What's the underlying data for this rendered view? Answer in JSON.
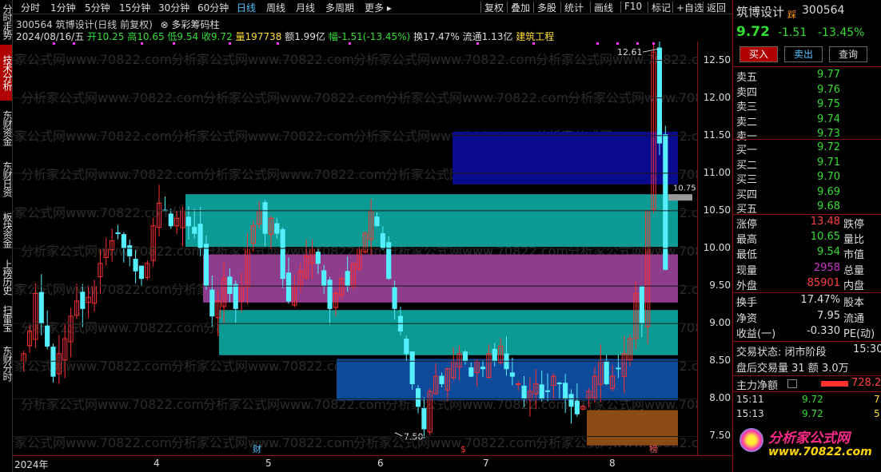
{
  "left_tabs": [
    {
      "label": "分时走势",
      "active": false
    },
    {
      "label": "技术分析",
      "active": true
    },
    {
      "label": "东财资金",
      "active": false
    },
    {
      "label": "东财日资",
      "active": false
    },
    {
      "label": "板块资金",
      "active": false
    },
    {
      "label": "上榜历史",
      "active": false
    },
    {
      "label": "扫雷宝",
      "active": false
    },
    {
      "label": "东财分时",
      "active": false
    }
  ],
  "toolbar": {
    "periods": [
      "分时",
      "1分钟",
      "5分钟",
      "15分钟",
      "30分钟",
      "60分钟",
      "日线",
      "周线",
      "月线",
      "多周期",
      "更多 ▸"
    ],
    "selected": "日线",
    "tools": [
      "复权",
      "叠加",
      "多股",
      "统计",
      "画线",
      "F10",
      "标记",
      "+自选",
      "返回"
    ]
  },
  "info": {
    "line1": "300564 筑博设计(日线 前复权)",
    "indicator": "多彩筹码柱",
    "date": "2024/08/16/五",
    "open": "开10.25",
    "high": "高10.65",
    "low": "低9.54",
    "close": "收9.72",
    "volume": "量197738",
    "amount": "额1.99亿",
    "change": "幅-1.51(-13.45%)",
    "turnover": "换17.47%",
    "float": "流通1.13亿",
    "industry": "建筑工程"
  },
  "watermark": "分析家公式网www.70822.com",
  "chart_data": {
    "type": "candlestick",
    "ylim": [
      7.25,
      12.75
    ],
    "yticks": [
      "12.50",
      "12.00",
      "11.50",
      "11.00",
      "10.50",
      "10.00",
      "9.50",
      "9.00",
      "8.50",
      "8.00",
      "7.50"
    ],
    "xticks": [
      "2024年",
      "4",
      "5",
      "6",
      "7",
      "8"
    ],
    "x_markers": [
      {
        "label": "财",
        "color": "#4fc3ff"
      },
      {
        "label": "$",
        "color": "#ff3030"
      },
      {
        "label": "榜",
        "color": "#ff6060"
      }
    ],
    "annotations": [
      "12.61",
      "7.50",
      "10.75"
    ],
    "chip_bands": [
      {
        "low": 10.85,
        "high": 11.55,
        "color": "#0a0a8c"
      },
      {
        "low": 10.02,
        "high": 10.72,
        "color": "#0c9a94"
      },
      {
        "low": 9.28,
        "high": 9.92,
        "color": "#8e3c8c"
      },
      {
        "low": 8.58,
        "high": 9.18,
        "color": "#0c9a94"
      },
      {
        "low": 7.98,
        "high": 8.53,
        "color": "#0d4a9a"
      },
      {
        "low": 7.38,
        "high": 7.85,
        "color": "#8c4a14"
      }
    ],
    "closes": [
      8.6,
      8.9,
      9.4,
      9.0,
      8.7,
      8.3,
      8.6,
      8.8,
      9.1,
      9.3,
      9.2,
      9.35,
      9.5,
      9.8,
      10.0,
      10.1,
      10.2,
      10.0,
      9.9,
      9.7,
      9.6,
      9.8,
      10.3,
      10.6,
      10.5,
      10.3,
      10.4,
      10.5,
      10.3,
      10.2,
      10.0,
      9.5,
      9.1,
      9.3,
      9.6,
      9.4,
      9.2,
      9.5,
      10.0,
      10.3,
      10.5,
      10.2,
      10.4,
      10.2,
      9.6,
      9.3,
      9.5,
      9.7,
      9.9,
      10.0,
      9.8,
      9.5,
      9.2,
      9.4,
      9.6,
      9.5,
      9.8,
      10.0,
      10.2,
      10.5,
      10.3,
      10.0,
      9.6,
      9.2,
      8.9,
      8.6,
      8.2,
      7.9,
      7.6,
      8.1,
      8.3,
      8.2,
      8.4,
      8.5,
      8.6,
      8.5,
      8.3,
      8.5,
      8.4,
      8.6,
      8.5,
      8.7,
      8.4,
      8.3,
      8.2,
      8.0,
      8.1,
      8.2,
      8.0,
      8.1,
      8.3,
      8.2,
      8.0,
      7.9,
      7.8,
      7.9,
      8.1,
      8.3,
      8.5,
      8.2,
      8.3,
      8.4,
      8.6,
      8.8,
      9.4,
      9.0,
      10.5,
      12.61,
      11.4,
      9.72
    ]
  },
  "panel": {
    "name": "筑博设计",
    "tag": "踩",
    "code": "300564",
    "price": "9.72",
    "chg": "-1.51",
    "pct": "-13.45%",
    "buttons": [
      "买入",
      "卖出",
      "查询"
    ],
    "asks": [
      [
        "卖五",
        "9.77"
      ],
      [
        "卖四",
        "9.76"
      ],
      [
        "卖三",
        "9.75"
      ],
      [
        "卖二",
        "9.74"
      ],
      [
        "卖一",
        "9.73"
      ]
    ],
    "bids": [
      [
        "买一",
        "9.72"
      ],
      [
        "买二",
        "9.71"
      ],
      [
        "买三",
        "9.70"
      ],
      [
        "买四",
        "9.69"
      ],
      [
        "买五",
        "9.68"
      ]
    ],
    "stats": [
      {
        "l1": "涨停",
        "v1": "13.48",
        "c1": "#ff4040",
        "l2": "跌停"
      },
      {
        "l1": "最高",
        "v1": "10.65",
        "c1": "#33dd33",
        "l2": "量比"
      },
      {
        "l1": "最低",
        "v1": "9.54",
        "c1": "#33dd33",
        "l2": "市值"
      },
      {
        "l1": "现量",
        "v1": "2958",
        "c1": "#cc33cc",
        "l2": "总量"
      },
      {
        "l1": "外盘",
        "v1": "85901",
        "c1": "#ff4040",
        "l2": "内盘"
      }
    ],
    "stats2": [
      {
        "l1": "换手",
        "v1": "17.47%",
        "l2": "股本"
      },
      {
        "l1": "净资",
        "v1": "7.95",
        "l2": "流通"
      },
      {
        "l1": "收益(一)",
        "v1": "-0.330",
        "l2": "PE(动)"
      }
    ],
    "trade_state": "交易状态: 闭市阶段",
    "trade_time": "15:30",
    "after_hours": "盘后交易量 31 额 3.0万",
    "main_net_label": "主力净额",
    "main_net_value": "728.2",
    "ticks": [
      [
        "15:11",
        "9.72",
        "7"
      ],
      [
        "15:13",
        "9.72",
        "5"
      ],
      [
        "15:13",
        "9.72",
        ""
      ]
    ],
    "logo_text": "分析家公式网",
    "logo_url": "www.70822.com"
  }
}
